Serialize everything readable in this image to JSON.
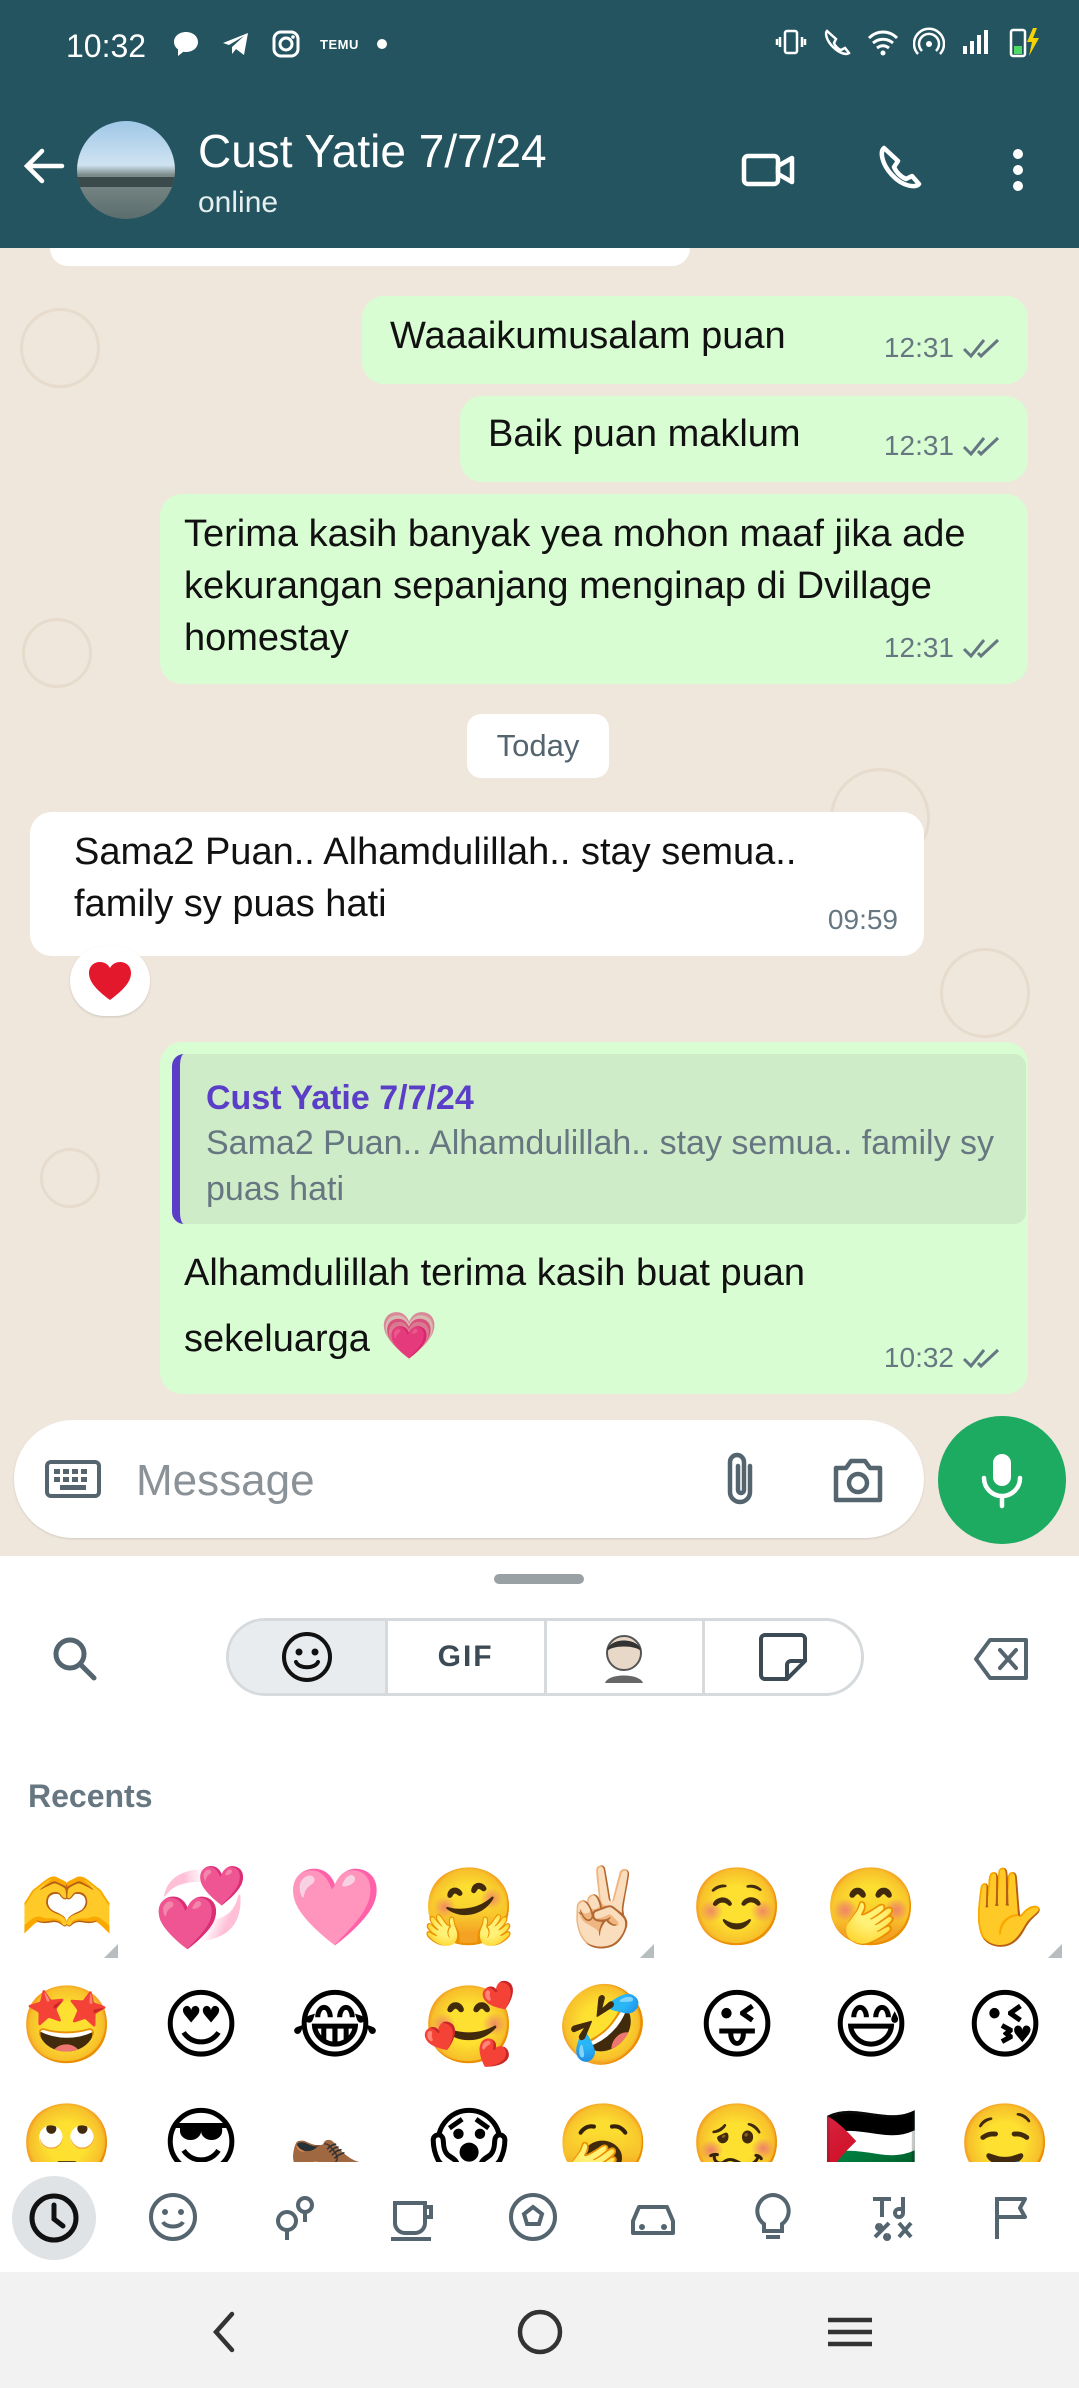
{
  "status_bar": {
    "time": "10:32",
    "temu": "TEMU"
  },
  "header": {
    "contact_name": "Cust Yatie 7/7/24",
    "contact_status": "online"
  },
  "messages": [
    {
      "direction": "out",
      "text": "Waaaikumusalam puan",
      "time": "12:31",
      "status": "read"
    },
    {
      "direction": "out",
      "text": "Baik puan maklum",
      "time": "12:31",
      "status": "read"
    },
    {
      "direction": "out",
      "text": "Terima kasih banyak yea mohon maaf jika ade kekurangan sepanjang menginap di Dvillage homestay",
      "time": "12:31",
      "status": "read"
    },
    {
      "direction": "in",
      "text": "Sama2 Puan.. Alhamdulillah.. stay semua.. family sy puas hati",
      "time": "09:59",
      "reaction": "❤️"
    },
    {
      "direction": "out",
      "quoted_name": "Cust Yatie 7/7/24",
      "quoted_text": "Sama2 Puan.. Alhamdulillah.. stay semua.. family sy puas hati",
      "text": "Alhamdulillah terima kasih buat puan sekeluarga",
      "emoji": "💗",
      "time": "10:32",
      "status": "read"
    }
  ],
  "day_divider": "Today",
  "composer": {
    "placeholder": "Message"
  },
  "emoji_panel": {
    "tabs": {
      "gif": "GIF"
    },
    "section_title": "Recents",
    "recents": [
      "🫶",
      "💞",
      "🩷",
      "🤗",
      "✌🏻",
      "☺️",
      "🤭",
      "✋",
      "🤩",
      "😍",
      "😂",
      "🥰",
      "🤣",
      "😜",
      "😅",
      "😘",
      "🙄",
      "😎",
      "👞",
      "😱",
      "🥱",
      "🥴",
      "🇵🇸",
      "🤤"
    ]
  },
  "colors": {
    "header": "#23545f",
    "outgoing_bubble": "#d9fdd3",
    "incoming_bubble": "#ffffff",
    "chat_bg": "#efe7dc",
    "accent": "#1daa61",
    "quote_name": "#5b3ec8"
  }
}
